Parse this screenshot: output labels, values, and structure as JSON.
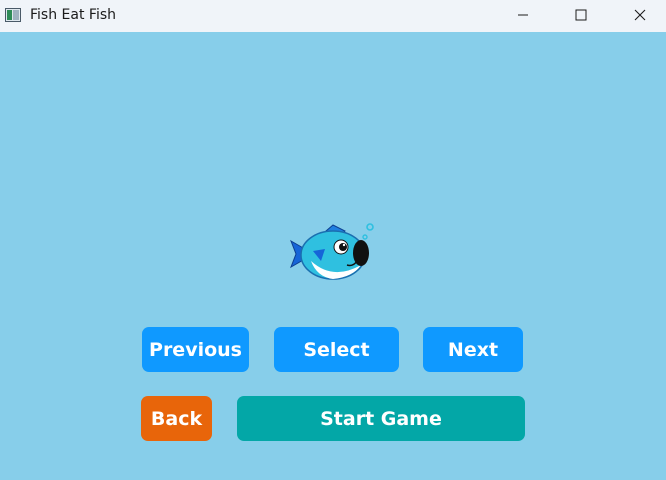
{
  "window": {
    "title": "Fish Eat Fish",
    "controls": [
      "minimize-icon",
      "maximize-icon",
      "close-icon"
    ]
  },
  "game": {
    "background_color": "#87ceea",
    "character": {
      "icon": "fish-icon",
      "colors": [
        "#2fc0e0",
        "#1565d8",
        "#ffffff",
        "#111111"
      ]
    }
  },
  "buttons": {
    "previous": "Previous",
    "select": "Select",
    "next": "Next",
    "back": "Back",
    "start": "Start Game"
  },
  "colors": {
    "blue_button": "#0f99ff",
    "orange_button": "#e8650a",
    "teal_button": "#03a7a7"
  }
}
